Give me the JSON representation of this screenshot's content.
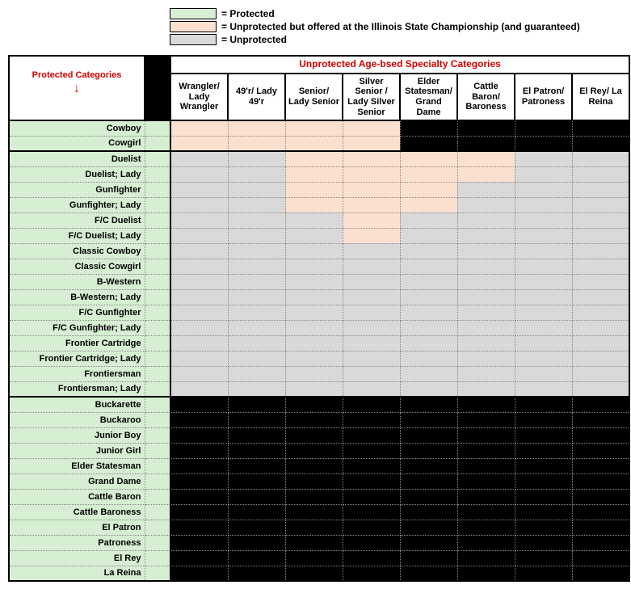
{
  "legend": {
    "protected": "= Protected",
    "offered": "= Unprotected but offered at the Illinois State Championship (and guaranteed)",
    "unprotected": "= Unprotected"
  },
  "headers": {
    "protected_categories": "Protected Categories",
    "span": "Unprotected Age-bsed Specialty Categories",
    "cols": [
      "Wrangler/ Lady Wrangler",
      "49'r/ Lady 49'r",
      "Senior/ Lady Senior",
      "Silver Senior / Lady Silver Senior",
      "Elder Statesman/ Grand Dame",
      "Cattle Baron/ Baroness",
      "El Patron/ Patroness",
      "El Rey/ La Reina"
    ]
  },
  "colors": {
    "protected": "#d6eed2",
    "offered": "#fbe0d0",
    "unprotected": "#d9d9d9",
    "black": "#000000",
    "red": "#d80000"
  },
  "rows": [
    {
      "label": "Cowboy",
      "cells": [
        "offered",
        "offered",
        "offered",
        "offered",
        "black",
        "black",
        "black",
        "black"
      ],
      "section": true
    },
    {
      "label": "Cowgirl",
      "cells": [
        "offered",
        "offered",
        "offered",
        "offered",
        "black",
        "black",
        "black",
        "black"
      ]
    },
    {
      "label": "Duelist",
      "cells": [
        "unprot",
        "unprot",
        "offered",
        "offered",
        "offered",
        "offered",
        "unprot",
        "unprot"
      ],
      "section": true
    },
    {
      "label": "Duelist; Lady",
      "cells": [
        "unprot",
        "unprot",
        "offered",
        "offered",
        "offered",
        "offered",
        "unprot",
        "unprot"
      ]
    },
    {
      "label": "Gunfighter",
      "cells": [
        "unprot",
        "unprot",
        "offered",
        "offered",
        "offered",
        "unprot",
        "unprot",
        "unprot"
      ]
    },
    {
      "label": "Gunfighter; Lady",
      "cells": [
        "unprot",
        "unprot",
        "offered",
        "offered",
        "offered",
        "unprot",
        "unprot",
        "unprot"
      ]
    },
    {
      "label": "F/C Duelist",
      "cells": [
        "unprot",
        "unprot",
        "unprot",
        "offered",
        "unprot",
        "unprot",
        "unprot",
        "unprot"
      ]
    },
    {
      "label": "F/C Duelist; Lady",
      "cells": [
        "unprot",
        "unprot",
        "unprot",
        "offered",
        "unprot",
        "unprot",
        "unprot",
        "unprot"
      ]
    },
    {
      "label": "Classic Cowboy",
      "cells": [
        "unprot",
        "unprot",
        "unprot",
        "unprot",
        "unprot",
        "unprot",
        "unprot",
        "unprot"
      ]
    },
    {
      "label": "Classic Cowgirl",
      "cells": [
        "unprot",
        "unprot",
        "unprot",
        "unprot",
        "unprot",
        "unprot",
        "unprot",
        "unprot"
      ]
    },
    {
      "label": "B-Western",
      "cells": [
        "unprot",
        "unprot",
        "unprot",
        "unprot",
        "unprot",
        "unprot",
        "unprot",
        "unprot"
      ]
    },
    {
      "label": "B-Western; Lady",
      "cells": [
        "unprot",
        "unprot",
        "unprot",
        "unprot",
        "unprot",
        "unprot",
        "unprot",
        "unprot"
      ]
    },
    {
      "label": "F/C Gunfighter",
      "cells": [
        "unprot",
        "unprot",
        "unprot",
        "unprot",
        "unprot",
        "unprot",
        "unprot",
        "unprot"
      ]
    },
    {
      "label": "F/C Gunfighter; Lady",
      "cells": [
        "unprot",
        "unprot",
        "unprot",
        "unprot",
        "unprot",
        "unprot",
        "unprot",
        "unprot"
      ]
    },
    {
      "label": "Frontier Cartridge",
      "cells": [
        "unprot",
        "unprot",
        "unprot",
        "unprot",
        "unprot",
        "unprot",
        "unprot",
        "unprot"
      ]
    },
    {
      "label": "Frontier Cartridge; Lady",
      "cells": [
        "unprot",
        "unprot",
        "unprot",
        "unprot",
        "unprot",
        "unprot",
        "unprot",
        "unprot"
      ]
    },
    {
      "label": "Frontiersman",
      "cells": [
        "unprot",
        "unprot",
        "unprot",
        "unprot",
        "unprot",
        "unprot",
        "unprot",
        "unprot"
      ]
    },
    {
      "label": "Frontiersman; Lady",
      "cells": [
        "unprot",
        "unprot",
        "unprot",
        "unprot",
        "unprot",
        "unprot",
        "unprot",
        "unprot"
      ]
    },
    {
      "label": "Buckarette",
      "cells": [
        "black",
        "black",
        "black",
        "black",
        "black",
        "black",
        "black",
        "black"
      ],
      "section": true
    },
    {
      "label": "Buckaroo",
      "cells": [
        "black",
        "black",
        "black",
        "black",
        "black",
        "black",
        "black",
        "black"
      ]
    },
    {
      "label": "Junior Boy",
      "cells": [
        "black",
        "black",
        "black",
        "black",
        "black",
        "black",
        "black",
        "black"
      ]
    },
    {
      "label": "Junior Girl",
      "cells": [
        "black",
        "black",
        "black",
        "black",
        "black",
        "black",
        "black",
        "black"
      ]
    },
    {
      "label": "Elder Statesman",
      "cells": [
        "black",
        "black",
        "black",
        "black",
        "black",
        "black",
        "black",
        "black"
      ]
    },
    {
      "label": "Grand Dame",
      "cells": [
        "black",
        "black",
        "black",
        "black",
        "black",
        "black",
        "black",
        "black"
      ]
    },
    {
      "label": "Cattle Baron",
      "cells": [
        "black",
        "black",
        "black",
        "black",
        "black",
        "black",
        "black",
        "black"
      ]
    },
    {
      "label": "Cattle Baroness",
      "cells": [
        "black",
        "black",
        "black",
        "black",
        "black",
        "black",
        "black",
        "black"
      ]
    },
    {
      "label": "El Patron",
      "cells": [
        "black",
        "black",
        "black",
        "black",
        "black",
        "black",
        "black",
        "black"
      ]
    },
    {
      "label": "Patroness",
      "cells": [
        "black",
        "black",
        "black",
        "black",
        "black",
        "black",
        "black",
        "black"
      ]
    },
    {
      "label": "El Rey",
      "cells": [
        "black",
        "black",
        "black",
        "black",
        "black",
        "black",
        "black",
        "black"
      ]
    },
    {
      "label": "La Reina",
      "cells": [
        "black",
        "black",
        "black",
        "black",
        "black",
        "black",
        "black",
        "black"
      ],
      "last": true
    }
  ]
}
